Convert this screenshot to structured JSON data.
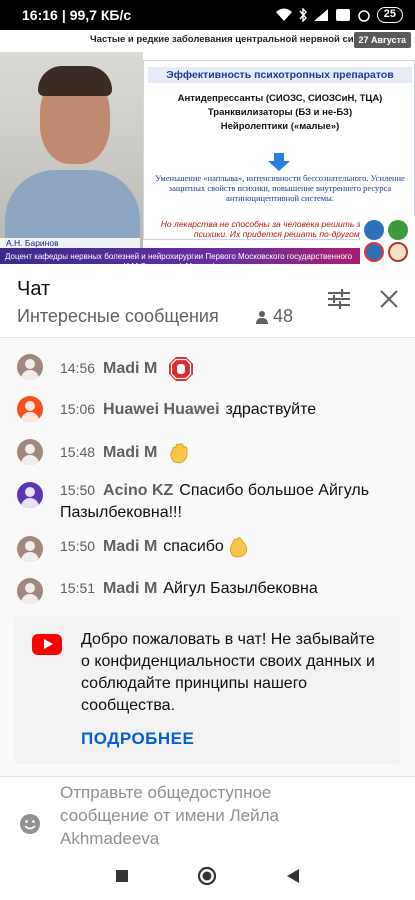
{
  "status_bar": {
    "time": "16:16",
    "network_speed": "99,7 КБ/с",
    "battery": "25"
  },
  "video": {
    "header_title": "Частые и редкие заболевания центральной нервной системы",
    "date_badge": "27 Августа",
    "slide": {
      "title": "Эффективность психотропных препаратов",
      "line1": "Антидепрессанты (СИОЗС, СИОЗСиН, ТЦА)",
      "line2": "Транквилизаторы (БЗ и не-БЗ)",
      "line3": "Нейролептики («малые»)",
      "blue_text": "Уменьшение «наплыва», интенсивности бессознательного. Усиление защитных свойств психики, повышение внутреннего ресурса антиноцицептивной системы.",
      "red_text": "Но лекарства не способны за человека решить задачи его психики. Их придется решать по-другому!"
    },
    "speaker_name": "А.Н. Баринов",
    "caption": "Доцент кафедры нервных болезней и нейрохирургии Первого Московского государственного медицинского университета им И.М.Сеченова (г.Москва)"
  },
  "chat_header": {
    "title": "Чат",
    "mode": "Интересные сообщения",
    "viewer_count": "48"
  },
  "messages": [
    {
      "time": "14:56",
      "author": "Madi M",
      "text": "",
      "emoji": "stop-hand-icon",
      "avatar_color": "#a1887f"
    },
    {
      "time": "15:06",
      "author": "Huawei Huawei",
      "text": "здраствуйте",
      "emoji": "",
      "avatar_color": "#f4511e"
    },
    {
      "time": "15:48",
      "author": "Madi M",
      "text": "",
      "emoji": "waving-hand-icon",
      "avatar_color": "#a1887f"
    },
    {
      "time": "15:50",
      "author": "Acino KZ",
      "text": "Спасибо большое Айгуль Пазылбековна!!!",
      "emoji": "",
      "avatar_color": "#5e35b1"
    },
    {
      "time": "15:50",
      "author": "Madi M",
      "text": "спасибо",
      "emoji": "clapping-hands-icon",
      "avatar_color": "#a1887f"
    },
    {
      "time": "15:51",
      "author": "Madi M",
      "text": "Айгул Базылбековна",
      "emoji": "",
      "avatar_color": "#a1887f"
    }
  ],
  "welcome": {
    "text": "Добро пожаловать в чат! Не забывайте о конфиденциальности своих данных и соблюдайте принципы нашего сообщества.",
    "more_label": "ПОДРОБНЕЕ"
  },
  "input": {
    "placeholder": "Отправьте общедоступное сообщение от имени Лейла Akhmadeeva"
  },
  "colors": {
    "accent": "#065fd4",
    "youtube_red": "#ff0000",
    "muted_text": "#606060"
  }
}
